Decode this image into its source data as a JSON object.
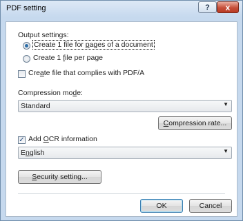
{
  "window": {
    "title": "PDF setting",
    "help_glyph": "?",
    "close_glyph": "x"
  },
  "output": {
    "heading": "Output settings:",
    "radio_one_file": {
      "pre": "Create 1 file for ",
      "key": "p",
      "post": "ages of a document",
      "selected": true
    },
    "radio_per_page": {
      "pre": "Create 1 ",
      "key": "f",
      "post": "ile per page",
      "selected": false
    }
  },
  "pdfa": {
    "pre": "Cre",
    "key": "a",
    "post": "te file that complies with PDF/A",
    "checked": false
  },
  "compression": {
    "label_pre": "Compression mo",
    "label_key": "d",
    "label_post": "e:",
    "selected": "Standard",
    "rate_button": {
      "pre": "",
      "key": "C",
      "post": "ompression rate..."
    }
  },
  "ocr": {
    "checked": true,
    "check_glyph": "✓",
    "label_pre": "Add ",
    "label_key": "O",
    "label_post": "CR information",
    "language_pre": "E",
    "language_key": "n",
    "language_post": "glish"
  },
  "security_button": {
    "pre": "",
    "key": "S",
    "post": "ecurity setting..."
  },
  "footer": {
    "ok": "OK",
    "cancel": "Cancel"
  },
  "icons": {
    "dropdown": "▼"
  }
}
